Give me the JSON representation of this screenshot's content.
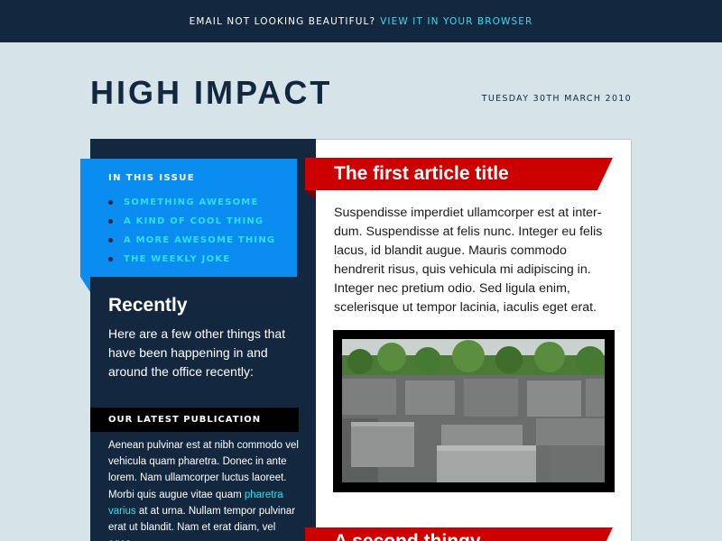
{
  "topbar": {
    "prefix": "EMAIL NOT LOOKING BEAUTIFUL?",
    "link": "VIEW IT IN YOUR BROWSER"
  },
  "header": {
    "title": "HIGH IMPACT",
    "date": "TUESDAY 30TH MARCH 2010"
  },
  "sidebar": {
    "issue_title": "IN THIS ISSUE",
    "issue_items": [
      "SOMETHING AWESOME",
      "A KIND OF COOL THING",
      "A MORE AWESOME THING",
      "THE WEEKLY JOKE"
    ],
    "recently_title": "Recently",
    "recently_text": "Here are a few other things that have been happening in and around the office recently:",
    "publication_title": "OUR LATEST PUBLICATION",
    "publication_text_before": "Aenean pulvinar est at nibh com­modo vel vehicula quam pharetra. Donec in ante lorem. Nam ullamcor­per luctus laoreet. Morbi quis augue vitae quam ",
    "publication_link": "pharetra varius",
    "publication_text_after": " at at urna. Nullam tempor pulvinar erat ut blandit. Nam et erat diam, vel eges-"
  },
  "main": {
    "article1_title": "The first article title",
    "article1_text": "Suspendisse imperdiet ullamcorper est at inter­dum. Suspendisse at felis nunc. Integer eu felis lacus, id blandit augue. Mauris commodo hendre­rit risus, quis vehicula mi adipiscing in. Integer nec pretium odio. Sed ligula enim, scelerisque ut tempor lacinia, iaculis eget erat.",
    "article2_title": "A second thingy"
  },
  "colors": {
    "navy": "#13283f",
    "accent_blue": "#0a8cf0",
    "cyan_link": "#2de0f0",
    "red_banner": "#cc0000",
    "background": "#d6e4ea"
  }
}
